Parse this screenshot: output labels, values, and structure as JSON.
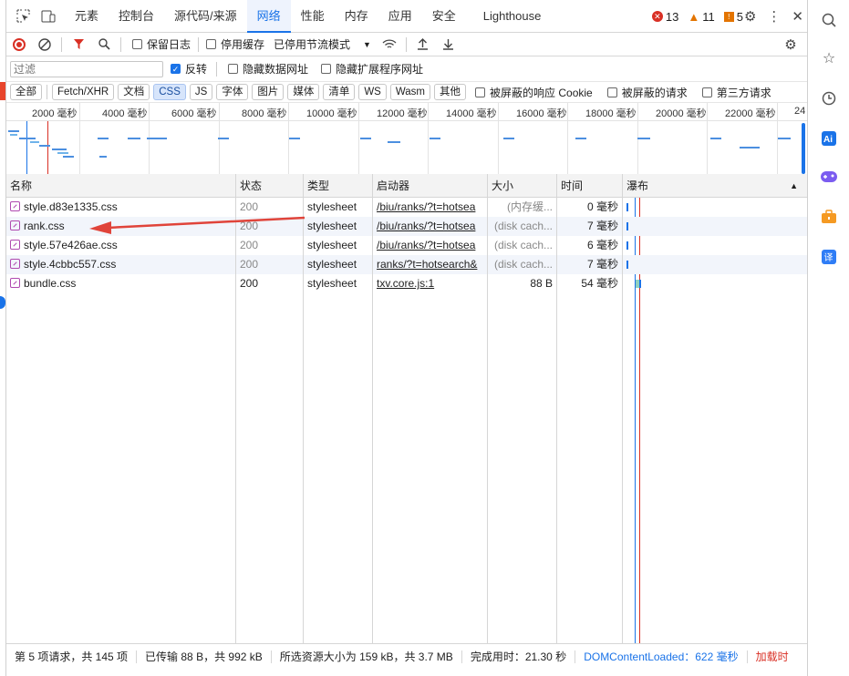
{
  "tabs": [
    {
      "label": "元素"
    },
    {
      "label": "控制台"
    },
    {
      "label": "源代码/来源"
    },
    {
      "label": "网络",
      "active": true
    },
    {
      "label": "性能"
    },
    {
      "label": "内存"
    },
    {
      "label": "应用"
    },
    {
      "label": "安全"
    },
    {
      "label": "Lighthouse"
    }
  ],
  "counts": {
    "errors": "13",
    "warnings": "11",
    "info": "5"
  },
  "toolbar": {
    "preserve_log": "保留日志",
    "disable_cache": "停用缓存",
    "throttle": "已停用节流模式"
  },
  "filter": {
    "placeholder": "过滤",
    "invert": "反转",
    "hide_data_urls": "隐藏数据网址",
    "hide_ext_urls": "隐藏扩展程序网址"
  },
  "types": [
    "全部",
    "Fetch/XHR",
    "文档",
    "CSS",
    "JS",
    "字体",
    "图片",
    "媒体",
    "清单",
    "WS",
    "Wasm",
    "其他"
  ],
  "type_checks": {
    "blocked_cookies": "被屏蔽的响应 Cookie",
    "blocked_requests": "被屏蔽的请求",
    "third_party": "第三方请求"
  },
  "ruler": [
    "2000 毫秒",
    "4000 毫秒",
    "6000 毫秒",
    "8000 毫秒",
    "10000 毫秒",
    "12000 毫秒",
    "14000 毫秒",
    "16000 毫秒",
    "18000 毫秒",
    "20000 毫秒",
    "22000 毫秒",
    "24"
  ],
  "columns": {
    "name": "名称",
    "status": "状态",
    "type": "类型",
    "initiator": "启动器",
    "size": "大小",
    "time": "时间",
    "waterfall": "瀑布"
  },
  "rows": [
    {
      "name": "style.d83e1335.css",
      "status": "200",
      "type": "stylesheet",
      "initiator": "/biu/ranks/?t=hotsea",
      "size": "(内存缓...",
      "time": "0 毫秒"
    },
    {
      "name": "rank.css",
      "status": "200",
      "type": "stylesheet",
      "initiator": "/biu/ranks/?t=hotsea",
      "size": "(disk cach...",
      "time": "7 毫秒"
    },
    {
      "name": "style.57e426ae.css",
      "status": "200",
      "type": "stylesheet",
      "initiator": "/biu/ranks/?t=hotsea",
      "size": "(disk cach...",
      "time": "6 毫秒"
    },
    {
      "name": "style.4cbbc557.css",
      "status": "200",
      "type": "stylesheet",
      "initiator": "ranks/?t=hotsearch&",
      "size": "(disk cach...",
      "time": "7 毫秒"
    },
    {
      "name": "bundle.css",
      "status": "200",
      "type": "stylesheet",
      "initiator": "txv.core.js:1",
      "size": "88 B",
      "time": "54 毫秒"
    }
  ],
  "statusbar": {
    "requests": "第 5 项请求，共 145 项",
    "transferred": "已传输 88 B，共 992 kB",
    "resources": "所选资源大小为 159 kB，共 3.7 MB",
    "finish": "完成用时：21.30 秒",
    "dcl": "DOMContentLoaded：622 毫秒",
    "load": "加载时"
  },
  "colors": {
    "accent": "#1a73e8",
    "error": "#d93025",
    "warning": "#e37400",
    "arrow": "#e0443a"
  }
}
